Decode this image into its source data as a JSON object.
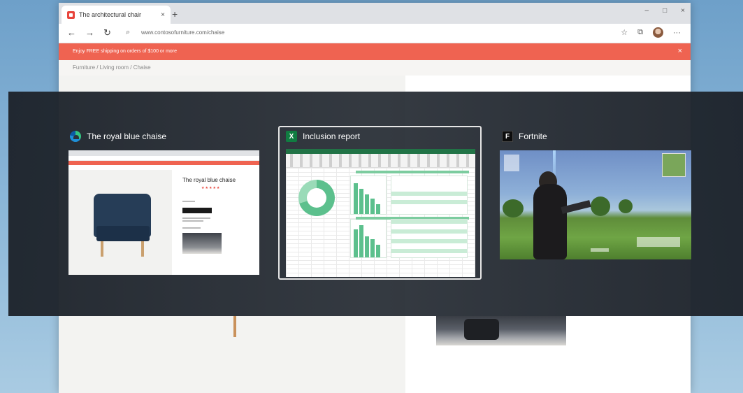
{
  "browser": {
    "tab_title": "The architectural chair",
    "tab_close": "×",
    "new_tab": "+",
    "url": "www.contosofurniture.com/chaise",
    "promo_text": "Enjoy FREE shipping on orders of $100 or more",
    "promo_close": "×",
    "breadcrumb": "Furniture  /  Living room  /  Chaise",
    "window_controls": {
      "minimize": "–",
      "maximize": "□",
      "close": "×"
    },
    "nav": {
      "back": "←",
      "forward": "→",
      "refresh": "↻",
      "search_icon": "⌕"
    },
    "toolbar": {
      "favorite": "☆",
      "collections": "⧉",
      "more": "···"
    }
  },
  "switcher": {
    "windows": [
      {
        "title": "The royal blue chaise",
        "icon": "edge-icon",
        "thumbnail": {
          "product_title": "The royal blue chaise",
          "stars": "★★★★★"
        }
      },
      {
        "title": "Inclusion report",
        "icon": "excel-icon",
        "icon_letter": "X",
        "selected": true
      },
      {
        "title": "Fortnite",
        "icon": "fortnite-icon",
        "icon_letter": "F"
      }
    ]
  },
  "colors": {
    "promo": "#ef6351",
    "excel_green": "#107c41",
    "selection_border": "#e6e6e6",
    "switcher_bg": "#262c34"
  }
}
